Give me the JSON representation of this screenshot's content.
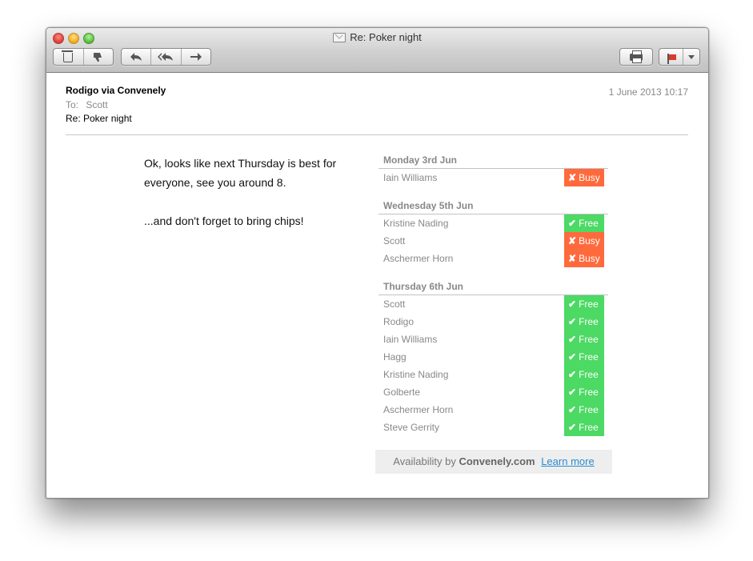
{
  "window": {
    "title": "Re: Poker night"
  },
  "toolbar": {
    "delete_icon": "trash-icon",
    "junk_icon": "thumbs-down-icon",
    "reply_glyph": "↩",
    "reply_all_glyph": "⇇",
    "forward_glyph": "➜",
    "print_icon": "printer-icon",
    "flag_icon": "flag-icon"
  },
  "message": {
    "sender": "Rodigo via Convenely",
    "to_label": "To:",
    "to_value": "Scott",
    "subject": "Re: Poker night",
    "date": "1 June 2013 10:17",
    "body_line1": "Ok, looks like next Thursday is best for everyone, see you around 8.",
    "body_line2": "...and don't forget to bring chips!"
  },
  "status_marks": {
    "free": "✔",
    "busy": "✘"
  },
  "days": [
    {
      "title": "Monday 3rd Jun",
      "people": [
        {
          "name": "Iain Williams",
          "status": "busy",
          "label": "Busy"
        }
      ]
    },
    {
      "title": "Wednesday 5th Jun",
      "people": [
        {
          "name": "Kristine Nading",
          "status": "free",
          "label": "Free"
        },
        {
          "name": "Scott",
          "status": "busy",
          "label": "Busy"
        },
        {
          "name": "Aschermer Horn",
          "status": "busy",
          "label": "Busy"
        }
      ]
    },
    {
      "title": "Thursday 6th Jun",
      "people": [
        {
          "name": "Scott",
          "status": "free",
          "label": "Free"
        },
        {
          "name": "Rodigo",
          "status": "free",
          "label": "Free"
        },
        {
          "name": "Iain Williams",
          "status": "free",
          "label": "Free"
        },
        {
          "name": "Hagg",
          "status": "free",
          "label": "Free"
        },
        {
          "name": "Kristine Nading",
          "status": "free",
          "label": "Free"
        },
        {
          "name": "Golberte",
          "status": "free",
          "label": "Free"
        },
        {
          "name": "Aschermer Horn",
          "status": "free",
          "label": "Free"
        },
        {
          "name": "Steve Gerrity",
          "status": "free",
          "label": "Free"
        }
      ]
    }
  ],
  "footer": {
    "prefix": "Availability by",
    "brand": "Convenely.com",
    "link": "Learn more"
  },
  "colors": {
    "free": "#4cd964",
    "busy": "#ff6a3d",
    "link": "#2b8ccf"
  }
}
